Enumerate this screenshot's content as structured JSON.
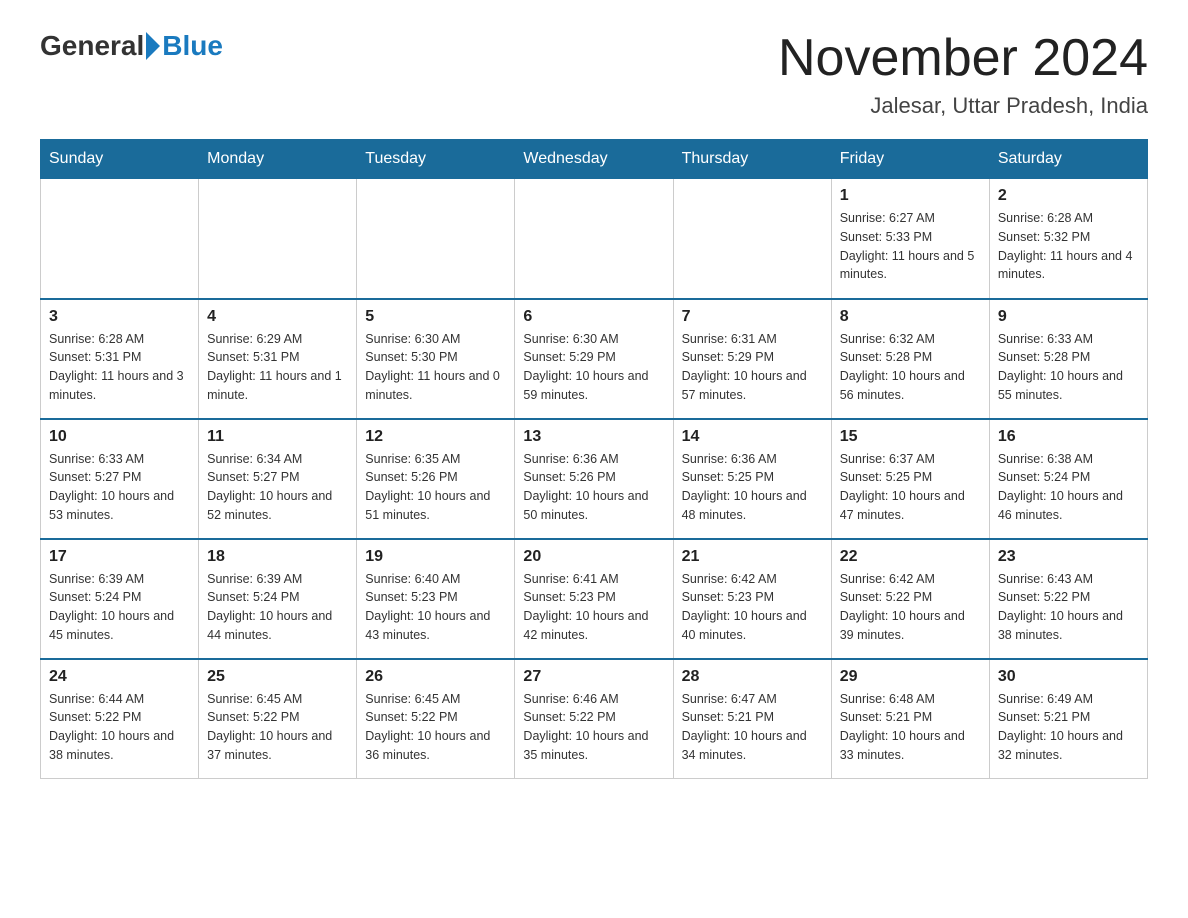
{
  "header": {
    "logo_general": "General",
    "logo_blue": "Blue",
    "month_title": "November 2024",
    "location": "Jalesar, Uttar Pradesh, India"
  },
  "weekdays": [
    "Sunday",
    "Monday",
    "Tuesday",
    "Wednesday",
    "Thursday",
    "Friday",
    "Saturday"
  ],
  "weeks": [
    [
      {
        "day": "",
        "sunrise": "",
        "sunset": "",
        "daylight": ""
      },
      {
        "day": "",
        "sunrise": "",
        "sunset": "",
        "daylight": ""
      },
      {
        "day": "",
        "sunrise": "",
        "sunset": "",
        "daylight": ""
      },
      {
        "day": "",
        "sunrise": "",
        "sunset": "",
        "daylight": ""
      },
      {
        "day": "",
        "sunrise": "",
        "sunset": "",
        "daylight": ""
      },
      {
        "day": "1",
        "sunrise": "Sunrise: 6:27 AM",
        "sunset": "Sunset: 5:33 PM",
        "daylight": "Daylight: 11 hours and 5 minutes."
      },
      {
        "day": "2",
        "sunrise": "Sunrise: 6:28 AM",
        "sunset": "Sunset: 5:32 PM",
        "daylight": "Daylight: 11 hours and 4 minutes."
      }
    ],
    [
      {
        "day": "3",
        "sunrise": "Sunrise: 6:28 AM",
        "sunset": "Sunset: 5:31 PM",
        "daylight": "Daylight: 11 hours and 3 minutes."
      },
      {
        "day": "4",
        "sunrise": "Sunrise: 6:29 AM",
        "sunset": "Sunset: 5:31 PM",
        "daylight": "Daylight: 11 hours and 1 minute."
      },
      {
        "day": "5",
        "sunrise": "Sunrise: 6:30 AM",
        "sunset": "Sunset: 5:30 PM",
        "daylight": "Daylight: 11 hours and 0 minutes."
      },
      {
        "day": "6",
        "sunrise": "Sunrise: 6:30 AM",
        "sunset": "Sunset: 5:29 PM",
        "daylight": "Daylight: 10 hours and 59 minutes."
      },
      {
        "day": "7",
        "sunrise": "Sunrise: 6:31 AM",
        "sunset": "Sunset: 5:29 PM",
        "daylight": "Daylight: 10 hours and 57 minutes."
      },
      {
        "day": "8",
        "sunrise": "Sunrise: 6:32 AM",
        "sunset": "Sunset: 5:28 PM",
        "daylight": "Daylight: 10 hours and 56 minutes."
      },
      {
        "day": "9",
        "sunrise": "Sunrise: 6:33 AM",
        "sunset": "Sunset: 5:28 PM",
        "daylight": "Daylight: 10 hours and 55 minutes."
      }
    ],
    [
      {
        "day": "10",
        "sunrise": "Sunrise: 6:33 AM",
        "sunset": "Sunset: 5:27 PM",
        "daylight": "Daylight: 10 hours and 53 minutes."
      },
      {
        "day": "11",
        "sunrise": "Sunrise: 6:34 AM",
        "sunset": "Sunset: 5:27 PM",
        "daylight": "Daylight: 10 hours and 52 minutes."
      },
      {
        "day": "12",
        "sunrise": "Sunrise: 6:35 AM",
        "sunset": "Sunset: 5:26 PM",
        "daylight": "Daylight: 10 hours and 51 minutes."
      },
      {
        "day": "13",
        "sunrise": "Sunrise: 6:36 AM",
        "sunset": "Sunset: 5:26 PM",
        "daylight": "Daylight: 10 hours and 50 minutes."
      },
      {
        "day": "14",
        "sunrise": "Sunrise: 6:36 AM",
        "sunset": "Sunset: 5:25 PM",
        "daylight": "Daylight: 10 hours and 48 minutes."
      },
      {
        "day": "15",
        "sunrise": "Sunrise: 6:37 AM",
        "sunset": "Sunset: 5:25 PM",
        "daylight": "Daylight: 10 hours and 47 minutes."
      },
      {
        "day": "16",
        "sunrise": "Sunrise: 6:38 AM",
        "sunset": "Sunset: 5:24 PM",
        "daylight": "Daylight: 10 hours and 46 minutes."
      }
    ],
    [
      {
        "day": "17",
        "sunrise": "Sunrise: 6:39 AM",
        "sunset": "Sunset: 5:24 PM",
        "daylight": "Daylight: 10 hours and 45 minutes."
      },
      {
        "day": "18",
        "sunrise": "Sunrise: 6:39 AM",
        "sunset": "Sunset: 5:24 PM",
        "daylight": "Daylight: 10 hours and 44 minutes."
      },
      {
        "day": "19",
        "sunrise": "Sunrise: 6:40 AM",
        "sunset": "Sunset: 5:23 PM",
        "daylight": "Daylight: 10 hours and 43 minutes."
      },
      {
        "day": "20",
        "sunrise": "Sunrise: 6:41 AM",
        "sunset": "Sunset: 5:23 PM",
        "daylight": "Daylight: 10 hours and 42 minutes."
      },
      {
        "day": "21",
        "sunrise": "Sunrise: 6:42 AM",
        "sunset": "Sunset: 5:23 PM",
        "daylight": "Daylight: 10 hours and 40 minutes."
      },
      {
        "day": "22",
        "sunrise": "Sunrise: 6:42 AM",
        "sunset": "Sunset: 5:22 PM",
        "daylight": "Daylight: 10 hours and 39 minutes."
      },
      {
        "day": "23",
        "sunrise": "Sunrise: 6:43 AM",
        "sunset": "Sunset: 5:22 PM",
        "daylight": "Daylight: 10 hours and 38 minutes."
      }
    ],
    [
      {
        "day": "24",
        "sunrise": "Sunrise: 6:44 AM",
        "sunset": "Sunset: 5:22 PM",
        "daylight": "Daylight: 10 hours and 38 minutes."
      },
      {
        "day": "25",
        "sunrise": "Sunrise: 6:45 AM",
        "sunset": "Sunset: 5:22 PM",
        "daylight": "Daylight: 10 hours and 37 minutes."
      },
      {
        "day": "26",
        "sunrise": "Sunrise: 6:45 AM",
        "sunset": "Sunset: 5:22 PM",
        "daylight": "Daylight: 10 hours and 36 minutes."
      },
      {
        "day": "27",
        "sunrise": "Sunrise: 6:46 AM",
        "sunset": "Sunset: 5:22 PM",
        "daylight": "Daylight: 10 hours and 35 minutes."
      },
      {
        "day": "28",
        "sunrise": "Sunrise: 6:47 AM",
        "sunset": "Sunset: 5:21 PM",
        "daylight": "Daylight: 10 hours and 34 minutes."
      },
      {
        "day": "29",
        "sunrise": "Sunrise: 6:48 AM",
        "sunset": "Sunset: 5:21 PM",
        "daylight": "Daylight: 10 hours and 33 minutes."
      },
      {
        "day": "30",
        "sunrise": "Sunrise: 6:49 AM",
        "sunset": "Sunset: 5:21 PM",
        "daylight": "Daylight: 10 hours and 32 minutes."
      }
    ]
  ]
}
